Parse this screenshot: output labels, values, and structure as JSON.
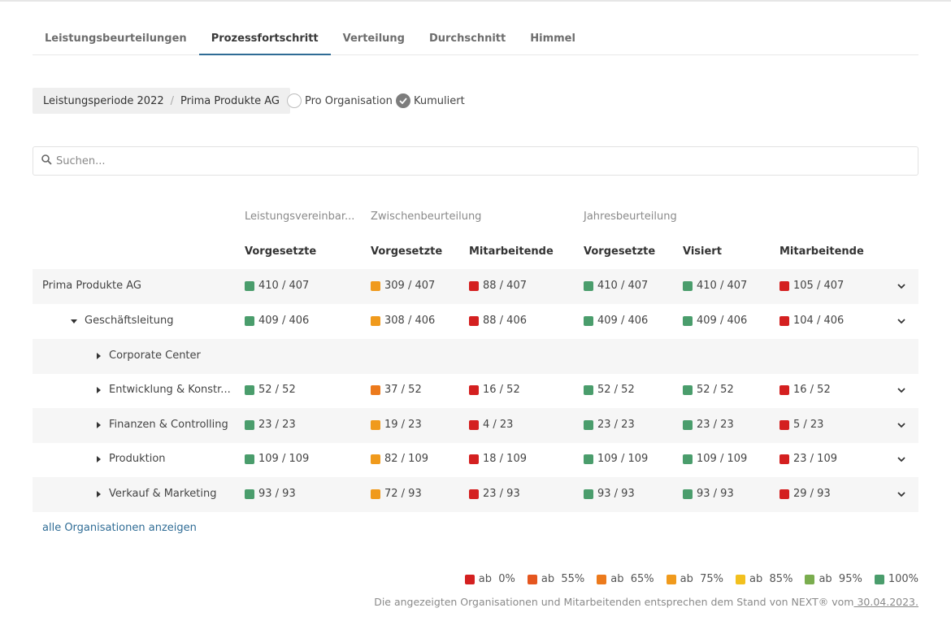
{
  "tabs": [
    "Leistungsbeurteilungen",
    "Prozessfortschritt",
    "Verteilung",
    "Durchschnitt",
    "Himmel"
  ],
  "active_tab": "Prozessfortschritt",
  "breadcrumb": {
    "period": "Leistungsperiode 2022",
    "separator": "/",
    "org": "Prima Produkte AG"
  },
  "radios": [
    {
      "label": "Pro Organisation",
      "checked": false
    },
    {
      "label": "Kumuliert",
      "checked": true
    }
  ],
  "search": {
    "placeholder": "Suchen...",
    "value": ""
  },
  "groups": [
    "Leistungsvereinbar...",
    "Zwischenbeurteilung",
    "Jahresbeurteilung"
  ],
  "columns": [
    "Vorgesetzte",
    "Vorgesetzte",
    "Mitarbeitende",
    "Vorgesetzte",
    "Visiert",
    "Mitarbeitende"
  ],
  "colors": {
    "red": "#d42020",
    "orange_red": "#e5561f",
    "orange": "#ec7a1c",
    "amber": "#f09a1c",
    "yellow": "#f2c01e",
    "light_green": "#7aad4e",
    "green": "#4a9d6c"
  },
  "rows": [
    {
      "name": "Prima Produkte AG",
      "level": 0,
      "caret": "none",
      "chevron": true,
      "shaded": true,
      "cells": [
        [
          "410 / 407",
          "green"
        ],
        [
          "309 / 407",
          "amber"
        ],
        [
          "88 / 407",
          "red"
        ],
        [
          "410 / 407",
          "green"
        ],
        [
          "410 / 407",
          "green"
        ],
        [
          "105 / 407",
          "red"
        ]
      ]
    },
    {
      "name": "Geschäftsleitung",
      "level": 1,
      "caret": "down",
      "chevron": true,
      "shaded": false,
      "cells": [
        [
          "409 / 406",
          "green"
        ],
        [
          "308 / 406",
          "amber"
        ],
        [
          "88 / 406",
          "red"
        ],
        [
          "409 / 406",
          "green"
        ],
        [
          "409 / 406",
          "green"
        ],
        [
          "104 / 406",
          "red"
        ]
      ]
    },
    {
      "name": "Corporate Center",
      "level": 2,
      "caret": "right",
      "chevron": false,
      "shaded": true,
      "cells": []
    },
    {
      "name": "Entwicklung & Konstr...",
      "level": 2,
      "caret": "right",
      "chevron": true,
      "shaded": false,
      "cells": [
        [
          "52 / 52",
          "green"
        ],
        [
          "37 / 52",
          "orange"
        ],
        [
          "16 / 52",
          "red"
        ],
        [
          "52 / 52",
          "green"
        ],
        [
          "52 / 52",
          "green"
        ],
        [
          "16 / 52",
          "red"
        ]
      ]
    },
    {
      "name": "Finanzen & Controlling",
      "level": 2,
      "caret": "right",
      "chevron": true,
      "shaded": true,
      "cells": [
        [
          "23 / 23",
          "green"
        ],
        [
          "19 / 23",
          "amber"
        ],
        [
          "4 / 23",
          "red"
        ],
        [
          "23 / 23",
          "green"
        ],
        [
          "23 / 23",
          "green"
        ],
        [
          "5 / 23",
          "red"
        ]
      ]
    },
    {
      "name": "Produktion",
      "level": 2,
      "caret": "right",
      "chevron": true,
      "shaded": false,
      "cells": [
        [
          "109 / 109",
          "green"
        ],
        [
          "82 / 109",
          "amber"
        ],
        [
          "18 / 109",
          "red"
        ],
        [
          "109 / 109",
          "green"
        ],
        [
          "109 / 109",
          "green"
        ],
        [
          "23 / 109",
          "red"
        ]
      ]
    },
    {
      "name": "Verkauf & Marketing",
      "level": 2,
      "caret": "right",
      "chevron": true,
      "shaded": true,
      "cells": [
        [
          "93 / 93",
          "green"
        ],
        [
          "72 / 93",
          "amber"
        ],
        [
          "23 / 93",
          "red"
        ],
        [
          "93 / 93",
          "green"
        ],
        [
          "93 / 93",
          "green"
        ],
        [
          "29 / 93",
          "red"
        ]
      ]
    }
  ],
  "show_all_link": "alle Organisationen anzeigen",
  "legend": [
    {
      "label": "ab  0%",
      "color": "red"
    },
    {
      "label": "ab  55%",
      "color": "orange_red"
    },
    {
      "label": "ab  65%",
      "color": "orange"
    },
    {
      "label": "ab  75%",
      "color": "amber"
    },
    {
      "label": "ab  85%",
      "color": "yellow"
    },
    {
      "label": "ab  95%",
      "color": "light_green"
    },
    {
      "label": "100%",
      "color": "green"
    }
  ],
  "footer": {
    "text": "Die angezeigten Organisationen und Mitarbeitenden entsprechen dem Stand von NEXT® vom",
    "date": " 30.04.2023."
  }
}
